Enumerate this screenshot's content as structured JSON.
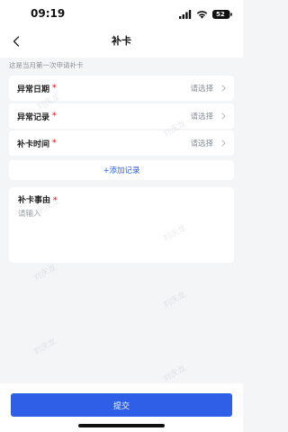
{
  "status_bar": {
    "time": "09:19",
    "battery": "52",
    "icons": [
      "signal-icon",
      "wifi-icon",
      "battery-icon"
    ]
  },
  "nav": {
    "back_icon": "chevron-left-icon",
    "title": "补卡"
  },
  "hint": "这是当月第一次申请补卡",
  "fields": [
    {
      "label": "异常日期",
      "required_mark": "*",
      "value": "请选择",
      "icon": "chevron-right-icon"
    },
    {
      "label": "异常记录",
      "required_mark": "*",
      "value": "请选择",
      "icon": "chevron-right-icon"
    },
    {
      "label": "补卡时间",
      "required_mark": "*",
      "value": "请选择",
      "icon": "chevron-right-icon"
    }
  ],
  "add_record_label": "+添加记录",
  "reason": {
    "label": "补卡事由",
    "required_mark": "*",
    "placeholder": "请输入"
  },
  "watermark": "刘庆龙",
  "submit_label": "提交",
  "colors": {
    "accent": "#2e5fe6",
    "required": "#e5393b",
    "background": "#f4f5f7"
  }
}
